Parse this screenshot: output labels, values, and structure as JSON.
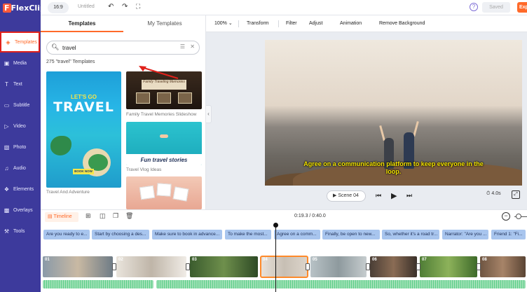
{
  "app": {
    "logo_text": "FlexClip",
    "aspect_ratio": "16:9",
    "doc_title": "Untitled",
    "saved_label": "Saved",
    "export_label": "Exp",
    "accent_color": "#ff6a2a",
    "sidebar_color": "#3d3a9c"
  },
  "sidebar": {
    "items": [
      {
        "label": "Templates",
        "icon": "layers-icon",
        "active": true
      },
      {
        "label": "Media",
        "icon": "media-icon"
      },
      {
        "label": "Text",
        "icon": "text-icon"
      },
      {
        "label": "Subtitle",
        "icon": "subtitle-icon"
      },
      {
        "label": "Video",
        "icon": "video-icon"
      },
      {
        "label": "Photo",
        "icon": "photo-icon"
      },
      {
        "label": "Audio",
        "icon": "music-icon"
      },
      {
        "label": "Elements",
        "icon": "elements-icon"
      },
      {
        "label": "Overlays",
        "icon": "overlays-icon"
      },
      {
        "label": "Tools",
        "icon": "tools-icon"
      }
    ]
  },
  "panel": {
    "tabs": [
      "Templates",
      "My Templates"
    ],
    "search": {
      "value": "travel"
    },
    "result_count": "275 \"travel\" Templates",
    "templates": [
      {
        "caption": "Travel And Adventure",
        "headline": "LET'S GO",
        "title": "TRAVEL",
        "button": "BOOK NOW"
      },
      {
        "caption": "Family Travel Memories Slideshow",
        "banner": "Family Traveling Memories"
      },
      {
        "caption": "Travel Vlog Ideas",
        "headline": "Fun travel stories"
      },
      {
        "caption": ""
      }
    ]
  },
  "edit_toolbar": {
    "zoom": "100%",
    "items": [
      "Transform",
      "Filter",
      "Adjust",
      "Animation",
      "Remove Background"
    ]
  },
  "preview": {
    "subtitle": "Agree on a communication platform to keep everyone in the loop.",
    "scene_label": "Scene 04",
    "duration": "4.0s"
  },
  "timeline": {
    "label": "Timeline",
    "time": "0:19.3 / 0:40.0",
    "captions": [
      "Are you ready to e...",
      "Start by choosing a des...",
      "Make sure to book in advance...",
      "To make the most...",
      "Agree on a comm...",
      "Finally, be open to new...",
      "So, whether it's a road tr...",
      "Narrator: \"Are you ...",
      "Friend 1: \"Fi..."
    ],
    "clips": [
      "01",
      "02",
      "03",
      "04",
      "05",
      "06",
      "07",
      "08"
    ],
    "selected_clip": "04"
  }
}
